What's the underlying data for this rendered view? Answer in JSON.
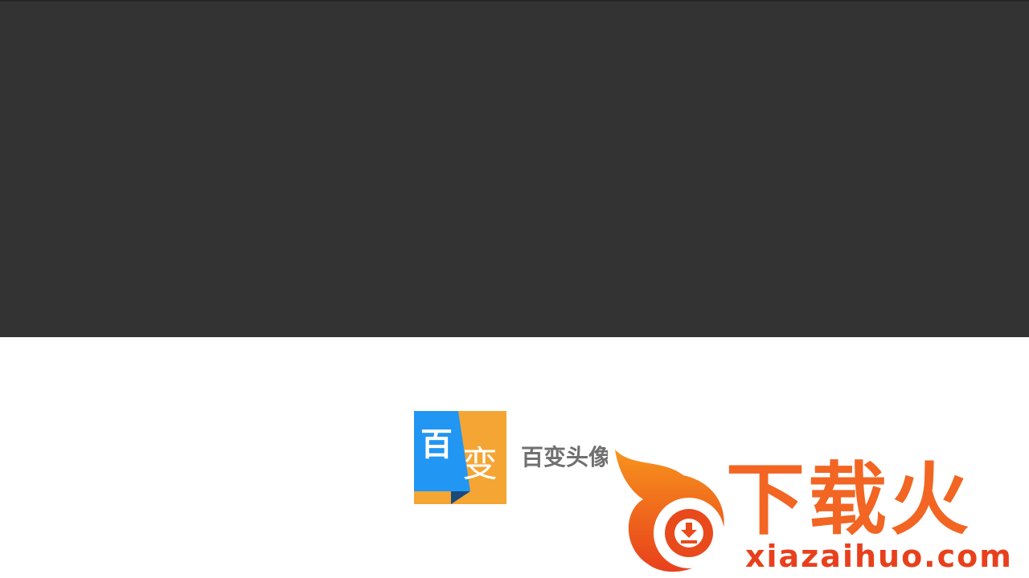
{
  "app": {
    "logo_char_1": "百",
    "logo_char_2": "变",
    "name": "百变头像",
    "colors": {
      "logo_blue": "#2196f3",
      "logo_orange": "#f4a533",
      "logo_fold": "#1a4a7a",
      "name_gray": "#707070"
    }
  },
  "watermark": {
    "title": "下载火",
    "url": "xiazaihuo.com",
    "icon": "flame-download-icon",
    "colors": {
      "orange": "#f26522",
      "red": "#e8401c"
    }
  },
  "background": {
    "top": "#333333",
    "bottom": "#ffffff"
  }
}
